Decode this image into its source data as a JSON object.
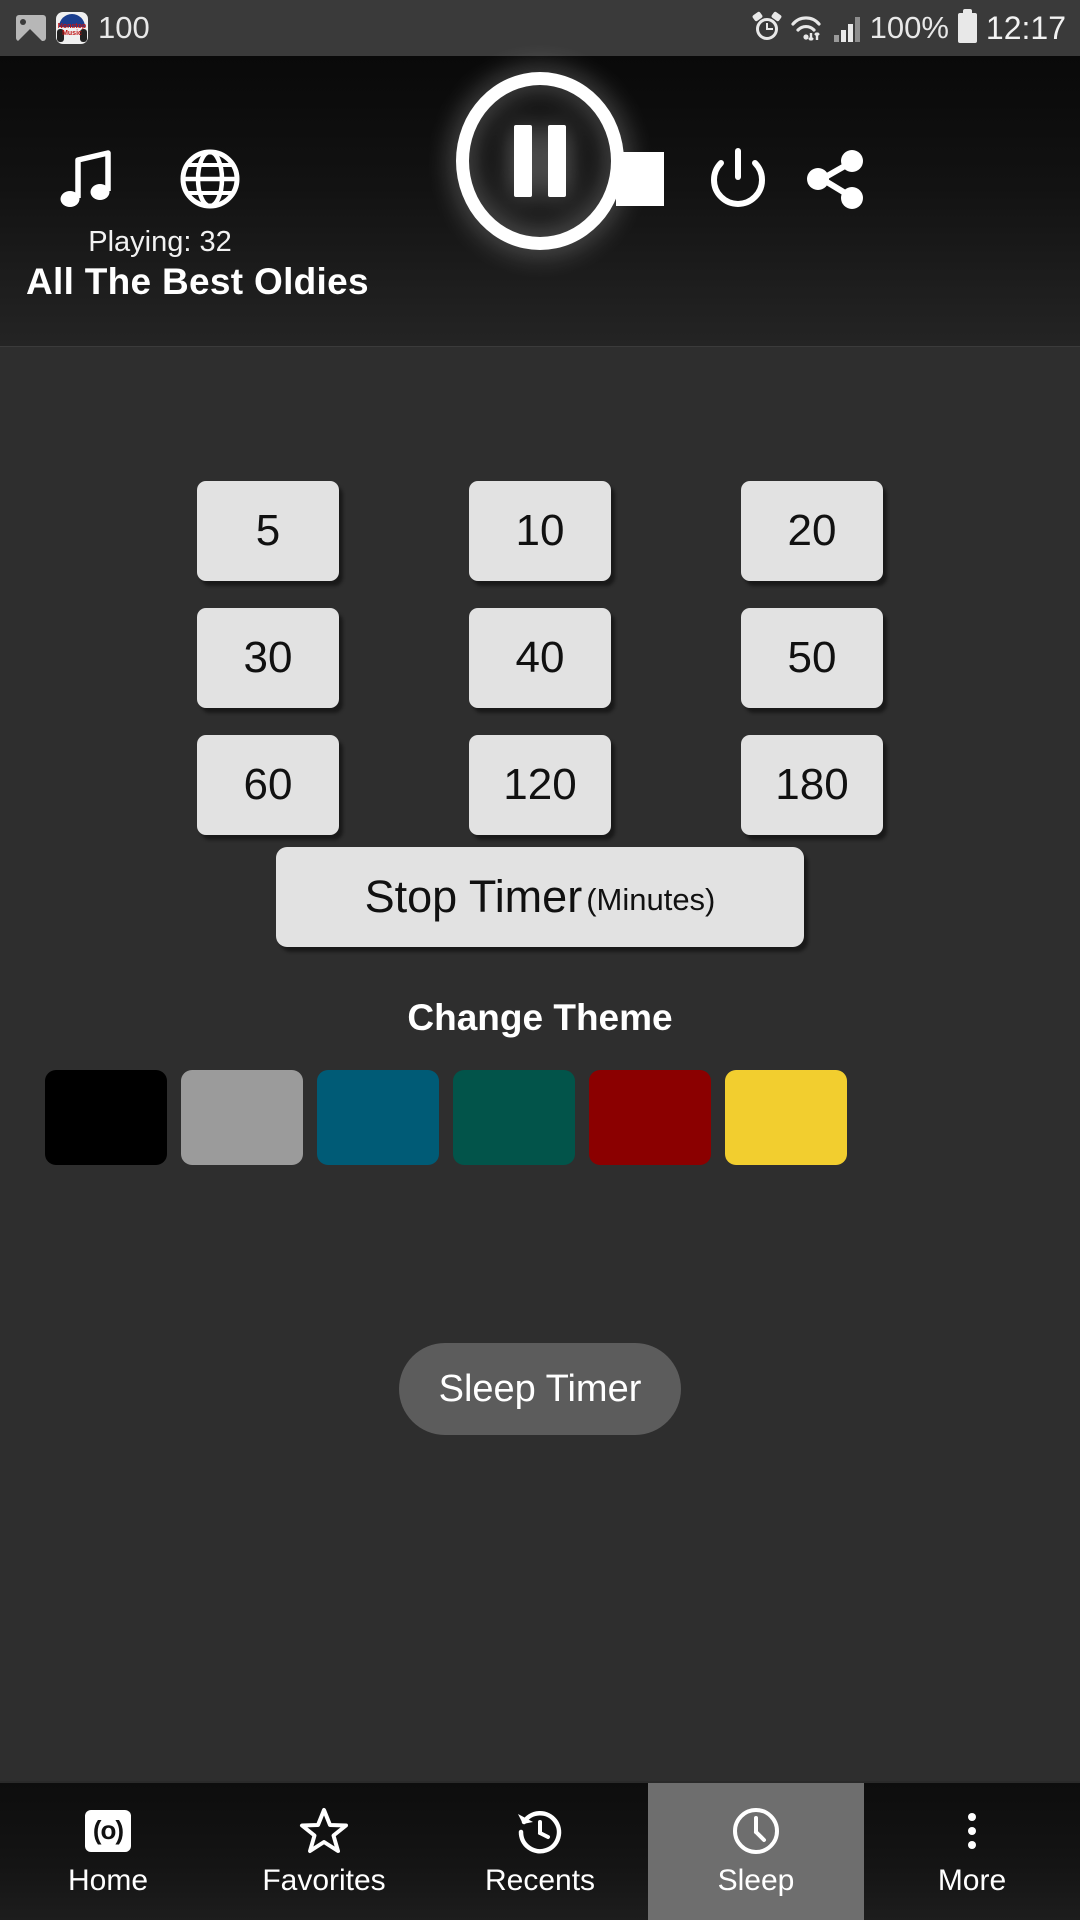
{
  "statusbar": {
    "left_icons": [
      {
        "name": "gallery-icon",
        "label": ""
      },
      {
        "name": "nonstop-music-app-icon",
        "label": "Nonstop Music"
      }
    ],
    "notification_count": "100",
    "alarm_icon": "alarm-icon",
    "wifi_icon": "wifi-icon",
    "signal_icon": "cellular-signal-icon",
    "battery_percent": "100%",
    "battery_icon": "battery-full-icon",
    "time": "12:17"
  },
  "player": {
    "music_icon": "music-note-icon",
    "globe_icon": "globe-icon",
    "play_pause_icon": "pause-icon",
    "stop_icon": "stop-icon",
    "power_icon": "power-icon",
    "share_icon": "share-icon",
    "playing_label": "Playing: 32",
    "station_title": "All The Best Oldies"
  },
  "timer": {
    "rows": [
      [
        "5",
        "10",
        "20"
      ],
      [
        "30",
        "40",
        "50"
      ],
      [
        "60",
        "120",
        "180"
      ]
    ],
    "stop_main": "Stop Timer",
    "stop_sub": "(Minutes)"
  },
  "theme": {
    "title": "Change Theme",
    "swatches": [
      {
        "name": "theme-black",
        "color": "#000000"
      },
      {
        "name": "theme-gray",
        "color": "#9b9b9b"
      },
      {
        "name": "theme-blue",
        "color": "#005b76"
      },
      {
        "name": "theme-green",
        "color": "#02544a"
      },
      {
        "name": "theme-red",
        "color": "#8b0000"
      },
      {
        "name": "theme-yellow",
        "color": "#f2ce2f"
      }
    ]
  },
  "sleep": {
    "button_label": "Sleep Timer"
  },
  "navbar": {
    "items": [
      {
        "name": "nav-home",
        "label": "Home",
        "icon": "radio-icon",
        "active": false
      },
      {
        "name": "nav-favorites",
        "label": "Favorites",
        "icon": "star-outline-icon",
        "active": false
      },
      {
        "name": "nav-recents",
        "label": "Recents",
        "icon": "history-icon",
        "active": false
      },
      {
        "name": "nav-sleep",
        "label": "Sleep",
        "icon": "clock-icon",
        "active": true
      },
      {
        "name": "nav-more",
        "label": "More",
        "icon": "overflow-menu-icon",
        "active": false
      }
    ]
  },
  "colors": {
    "body_bg": "#2e2e2e",
    "button_face": "#e2e2e2",
    "accent_selected": "#6e6e6e"
  }
}
